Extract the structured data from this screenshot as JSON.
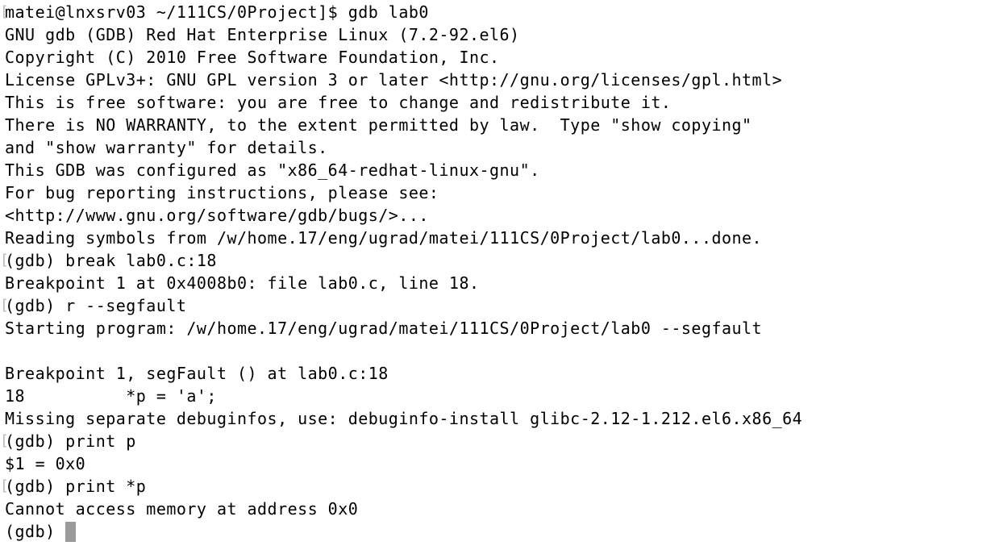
{
  "terminal": {
    "mark_glyph": "[",
    "lines": [
      {
        "text": "matei@lnxsrv03 ~/111CS/0Project]$ gdb lab0",
        "marked": true
      },
      {
        "text": "GNU gdb (GDB) Red Hat Enterprise Linux (7.2-92.el6)",
        "marked": false
      },
      {
        "text": "Copyright (C) 2010 Free Software Foundation, Inc.",
        "marked": false
      },
      {
        "text": "License GPLv3+: GNU GPL version 3 or later <http://gnu.org/licenses/gpl.html>",
        "marked": false
      },
      {
        "text": "This is free software: you are free to change and redistribute it.",
        "marked": false
      },
      {
        "text": "There is NO WARRANTY, to the extent permitted by law.  Type \"show copying\"",
        "marked": false
      },
      {
        "text": "and \"show warranty\" for details.",
        "marked": false
      },
      {
        "text": "This GDB was configured as \"x86_64-redhat-linux-gnu\".",
        "marked": false
      },
      {
        "text": "For bug reporting instructions, please see:",
        "marked": false
      },
      {
        "text": "<http://www.gnu.org/software/gdb/bugs/>...",
        "marked": false
      },
      {
        "text": "Reading symbols from /w/home.17/eng/ugrad/matei/111CS/0Project/lab0...done.",
        "marked": false
      },
      {
        "text": "(gdb) break lab0.c:18",
        "marked": true
      },
      {
        "text": "Breakpoint 1 at 0x4008b0: file lab0.c, line 18.",
        "marked": false
      },
      {
        "text": "(gdb) r --segfault",
        "marked": true
      },
      {
        "text": "Starting program: /w/home.17/eng/ugrad/matei/111CS/0Project/lab0 --segfault",
        "marked": false
      },
      {
        "text": "",
        "marked": false
      },
      {
        "text": "Breakpoint 1, segFault () at lab0.c:18",
        "marked": false
      },
      {
        "text": "18          *p = 'a';",
        "marked": false
      },
      {
        "text": "Missing separate debuginfos, use: debuginfo-install glibc-2.12-1.212.el6.x86_64",
        "marked": false
      },
      {
        "text": "(gdb) print p",
        "marked": true
      },
      {
        "text": "$1 = 0x0",
        "marked": false
      },
      {
        "text": "(gdb) print *p",
        "marked": true
      },
      {
        "text": "Cannot access memory at address 0x0",
        "marked": false
      }
    ],
    "prompt": "(gdb) ",
    "cursor_color": "#9a9a9a",
    "background": "#ffffff",
    "text_color": "#000000"
  }
}
